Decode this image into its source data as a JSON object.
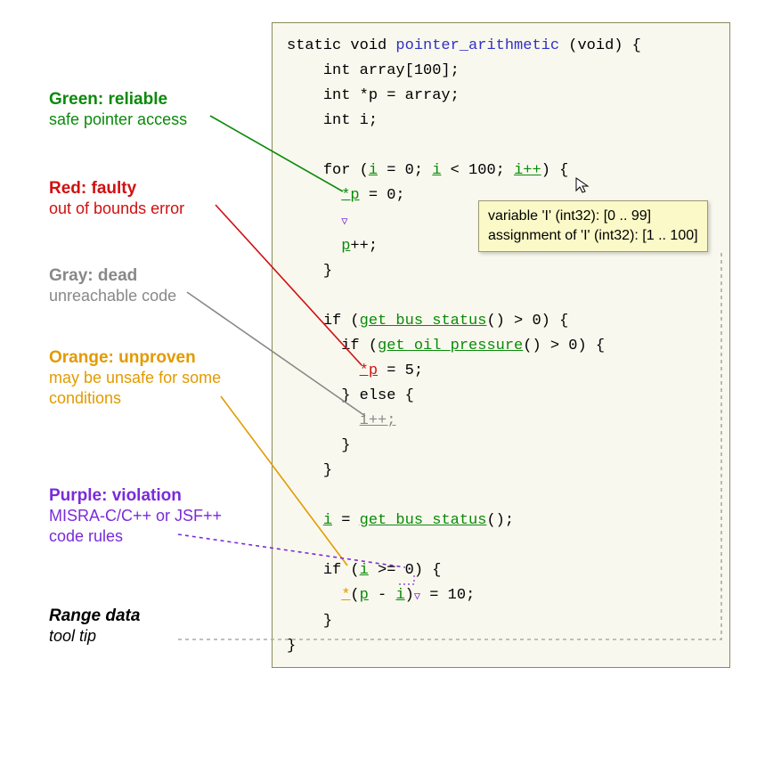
{
  "code": {
    "sig_pre": "static void ",
    "sig_fn": "pointer_arithmetic",
    "sig_post": " (void) {",
    "decl1": "int array[100];",
    "decl2": "int *p = array;",
    "decl3": "int i;",
    "for_pre": "for (",
    "for_i1": "i",
    "for_mid1": " = 0; ",
    "for_i2": "i",
    "for_mid2": " < 100; ",
    "for_inc": "i++",
    "for_post": ") {",
    "starp_g": "*p",
    "assign0": " = 0;",
    "p_under": "p",
    "pp": "++;",
    "brace": "}",
    "if_bus_pre": "if (",
    "get_bus": "get_bus_status",
    "call0": "() > 0) {",
    "get_oil": "get_oil_pressure",
    "starp_r": "*p",
    "assign5": " = 5;",
    "else": "} else {",
    "ipp_gray": "i++;",
    "i_g": "i",
    "eq_bus": " = ",
    "bus2": "get_bus_status",
    "bus2_post": "();",
    "if_ge_pre": "if (",
    "if_ge_post": " >= 0) {",
    "star_or": "*",
    "paren_open": "(",
    "p_g": "p",
    "minus": " - ",
    "i_g2": "i",
    "paren_close": ")",
    "assign10": " = 10;"
  },
  "tooltip": {
    "line1": "variable 'I' (int32): [0 .. 99]",
    "line2": "assignment of 'I' (int32): [1 .. 100]"
  },
  "legend": {
    "green": {
      "title": "Green: reliable",
      "sub": "safe pointer access",
      "color": "#0a8a0a"
    },
    "red": {
      "title": "Red: faulty",
      "sub": "out of bounds error",
      "color": "#d01010"
    },
    "gray": {
      "title": "Gray: dead",
      "sub": "unreachable code",
      "color": "#888888"
    },
    "orange": {
      "title": "Orange: unproven",
      "sub": "may be unsafe for some conditions",
      "color": "#e29a00"
    },
    "purple": {
      "title": "Purple: violation",
      "sub": "MISRA-C/C++ or JSF++ code rules",
      "color": "#7a2bd8"
    },
    "range": {
      "title": "Range data",
      "sub": "tool tip",
      "color": "#000000"
    }
  }
}
